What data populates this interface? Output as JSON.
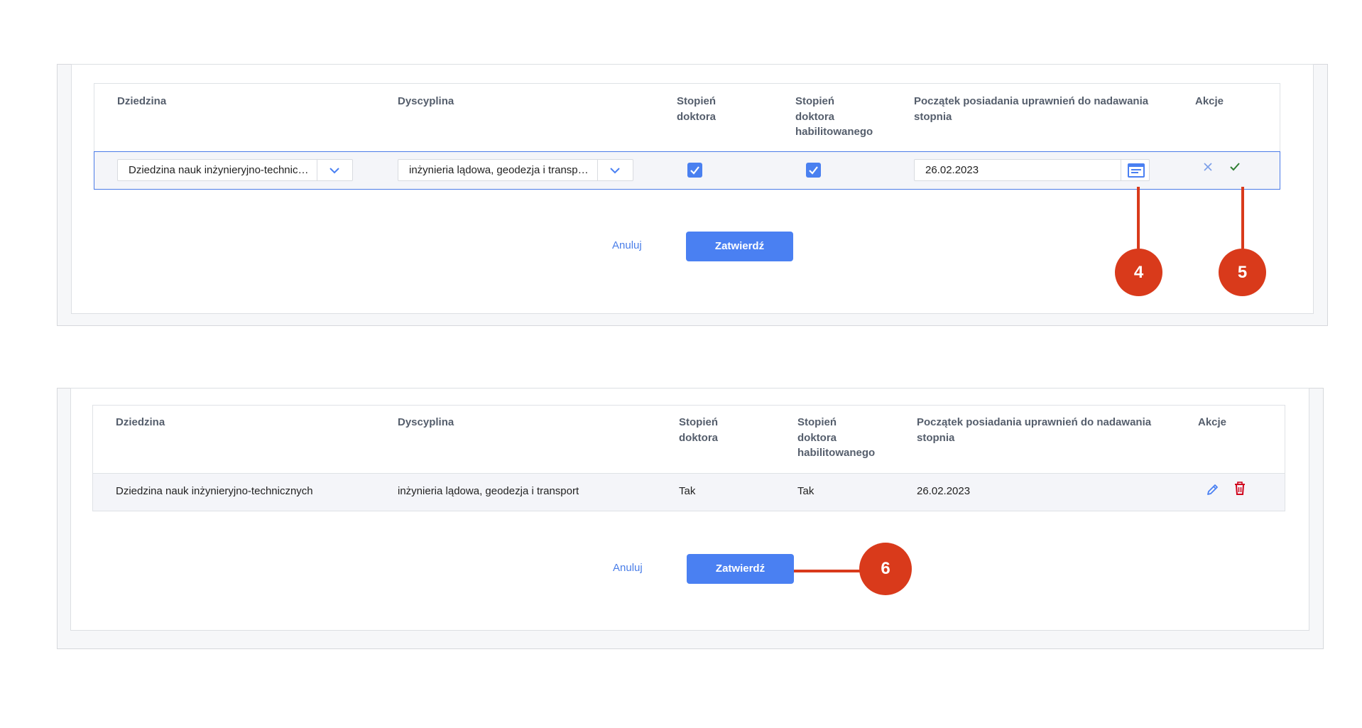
{
  "headers": {
    "dziedzina": "Dziedzina",
    "dyscyplina": "Dyscyplina",
    "stopien_doktora": [
      "Stopień",
      "doktora"
    ],
    "stopien_habilitowanego": [
      "Stopień",
      "doktora",
      "habilitowanego"
    ],
    "poczatek": [
      "Początek posiadania uprawnień do nadawania",
      "stopnia"
    ],
    "akcje": "Akcje"
  },
  "edit_row": {
    "dziedzina": "Dziedzina nauk inżynieryjno-technicznych",
    "dyscyplina": "inżynieria lądowa, geodezja i transport",
    "stopien_doktora_checked": true,
    "stopien_habilitowanego_checked": true,
    "date": "26.02.2023"
  },
  "view_row": {
    "dziedzina": "Dziedzina nauk inżynieryjno-technicznych",
    "dyscyplina": "inżynieria lądowa, geodezja i transport",
    "stopien_doktora": "Tak",
    "stopien_habilitowanego": "Tak",
    "date": "26.02.2023"
  },
  "buttons": {
    "cancel": "Anuluj",
    "confirm": "Zatwierdź"
  },
  "markers": [
    "4",
    "5",
    "6"
  ],
  "colors": {
    "accent": "#4a80f2",
    "marker": "#d93a1b",
    "delete": "#d0021b",
    "check": "#2e7d32"
  }
}
